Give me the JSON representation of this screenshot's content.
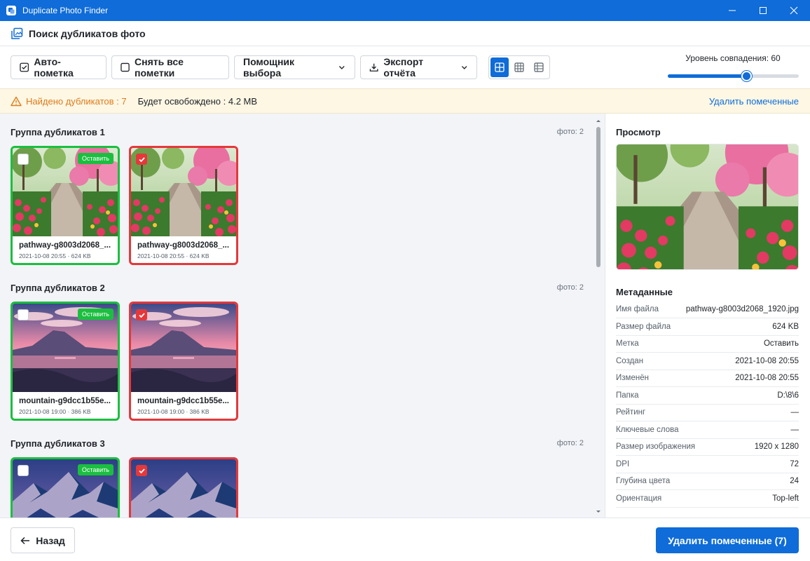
{
  "window": {
    "title": "Duplicate Photo Finder"
  },
  "header": {
    "title": "Поиск дубликатов фото"
  },
  "toolbar": {
    "auto_mark": "Авто-пометка",
    "unmark_all": "Снять все пометки",
    "selection_helper": "Помощник выбора",
    "export_report": "Экспорт отчёта",
    "similarity_label": "Уровень совпадения: 60",
    "similarity_value": 60,
    "similarity_max": 100,
    "active_view": "large-grid"
  },
  "infobar": {
    "found": "Найдено дубликатов : 7",
    "freed": "Будет освобождено : 4.2 MB",
    "delete_marked": "Удалить помеченные"
  },
  "groups": [
    {
      "title": "Группа дубликатов 1",
      "count": "фото: 2",
      "photos": [
        {
          "name": "pathway-g8003d2068_...",
          "meta": "2021-10-08 20:55 · 624 KB",
          "status": "keep",
          "badge": "Оставить"
        },
        {
          "name": "pathway-g8003d2068_...",
          "meta": "2021-10-08 20:55 · 624 KB",
          "status": "marked"
        }
      ]
    },
    {
      "title": "Группа дубликатов 2",
      "count": "фото: 2",
      "photos": [
        {
          "name": "mountain-g9dcc1b55e...",
          "meta": "2021-10-08 19:00 · 386 KB",
          "status": "keep",
          "badge": "Оставить"
        },
        {
          "name": "mountain-g9dcc1b55e...",
          "meta": "2021-10-08 19:00 · 386 KB",
          "status": "marked"
        }
      ]
    },
    {
      "title": "Группа дубликатов 3",
      "count": "фото: 2",
      "photos": [
        {
          "status": "keep",
          "badge": "Оставить"
        },
        {
          "status": "marked"
        }
      ]
    }
  ],
  "preview": {
    "title": "Просмотр",
    "metadata_title": "Метаданные",
    "metadata": [
      {
        "key": "Имя файла",
        "value": "pathway-g8003d2068_1920.jpg"
      },
      {
        "key": "Размер файла",
        "value": "624 KB"
      },
      {
        "key": "Метка",
        "value": "Оставить"
      },
      {
        "key": "Создан",
        "value": "2021-10-08 20:55"
      },
      {
        "key": "Изменён",
        "value": "2021-10-08 20:55"
      },
      {
        "key": "Папка",
        "value": "D:\\8\\6"
      },
      {
        "key": "Рейтинг",
        "value": "—"
      },
      {
        "key": "Ключевые слова",
        "value": "—"
      },
      {
        "key": "Размер изображения",
        "value": "1920 x 1280"
      },
      {
        "key": "DPI",
        "value": "72"
      },
      {
        "key": "Глубина цвета",
        "value": "24"
      },
      {
        "key": "Ориентация",
        "value": "Top-left"
      }
    ]
  },
  "footer": {
    "back": "Назад",
    "delete_marked": "Удалить помеченные (7)"
  },
  "colors": {
    "accent": "#0f6cd8",
    "keep": "#1bbf3f",
    "marked": "#e5383b",
    "warning": "#e07b1a"
  }
}
